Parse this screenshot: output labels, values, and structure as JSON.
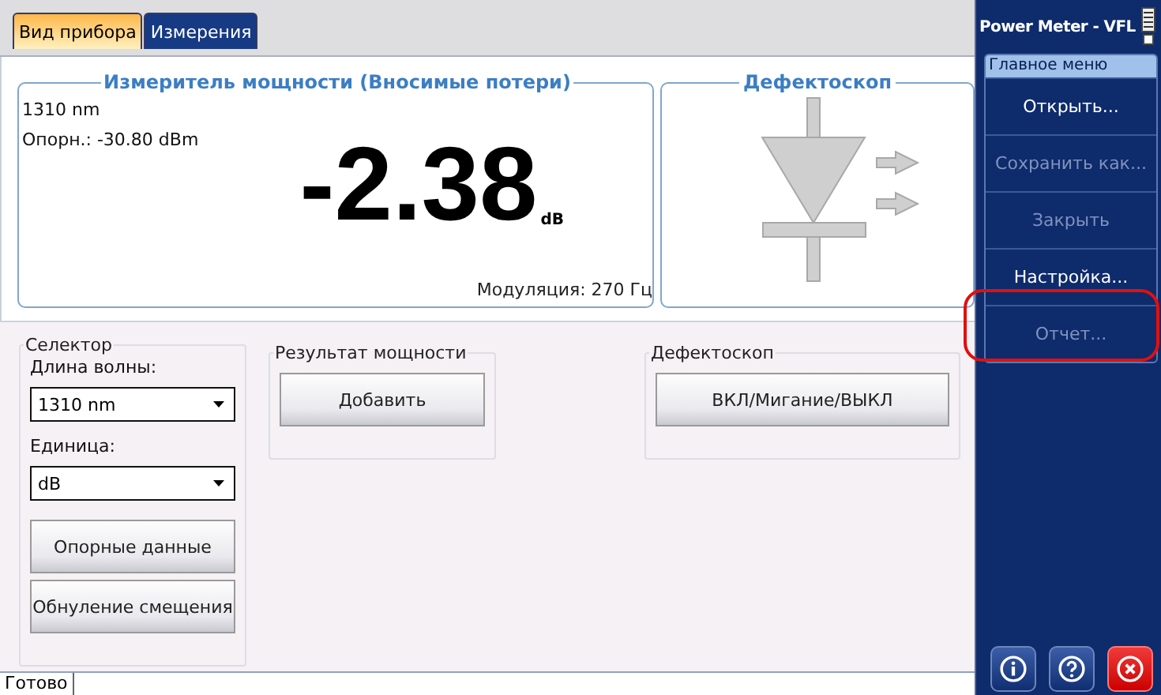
{
  "tabs": [
    {
      "label": "Вид прибора",
      "selected": true
    },
    {
      "label": "Измерения",
      "selected": false
    }
  ],
  "power_meter": {
    "title": "Измеритель мощности (Вносимые потери)",
    "wavelength": "1310 nm",
    "reference": "Опорн.: -30.80 dBm",
    "value": "-2.38",
    "unit": "dB",
    "modulation": "Модуляция: 270 Гц"
  },
  "vfl_panel": {
    "title": "Дефектоскоп"
  },
  "selector": {
    "title": "Селектор",
    "fields": [
      {
        "label": "Длина волны:",
        "value": "1310 nm"
      },
      {
        "label": "Единица:",
        "value": "dB"
      }
    ],
    "buttons": [
      "Опорные данные",
      "Обнуление смещения"
    ]
  },
  "power_result": {
    "title": "Результат мощности",
    "button": "Добавить"
  },
  "vfl_control": {
    "title": "Дефектоскоп",
    "button": "ВКЛ/Мигание/ВЫКЛ"
  },
  "status_bar": {
    "text": "Готово"
  },
  "sidebar": {
    "title": "Power Meter - VFL",
    "menu_title": "Главное меню",
    "items": [
      {
        "label": "Открыть...",
        "disabled": false,
        "highlighted": false
      },
      {
        "label": "Сохранить как...",
        "disabled": true,
        "highlighted": false
      },
      {
        "label": "Закрыть",
        "disabled": true,
        "highlighted": false
      },
      {
        "label": "Настройка...",
        "disabled": false,
        "highlighted": false
      },
      {
        "label": "Отчет...",
        "disabled": true,
        "highlighted": true
      }
    ]
  }
}
